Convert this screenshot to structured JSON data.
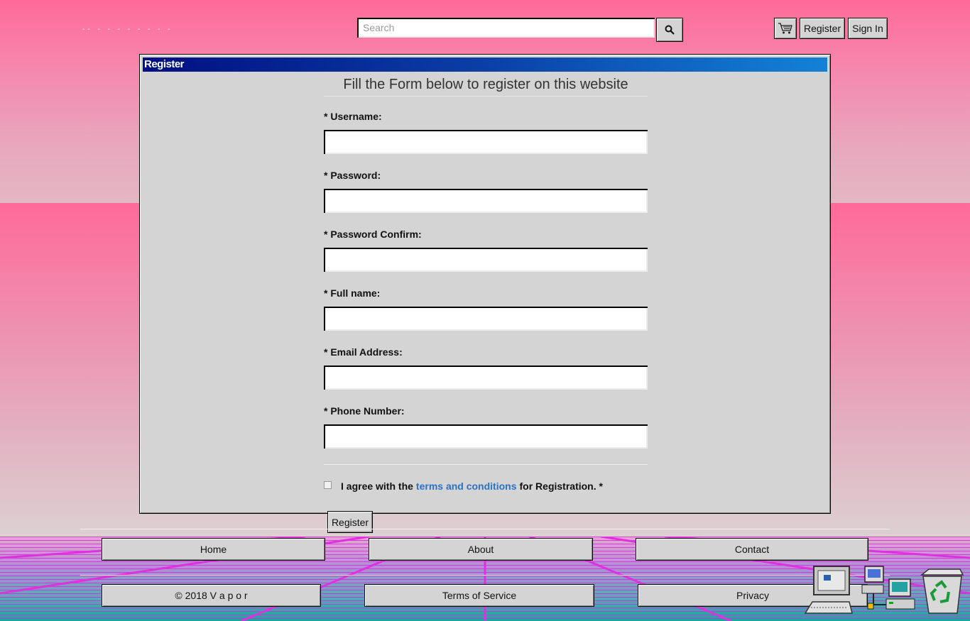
{
  "header": {
    "logo_text": "-- - - - - - - - -",
    "search": {
      "placeholder": "Search",
      "value": ""
    },
    "buttons": {
      "cart_icon": "cart-icon",
      "register": "Register",
      "sign_in": "Sign In"
    }
  },
  "window": {
    "title": "Register",
    "form_title": "Fill the Form below to register on this website",
    "fields": [
      {
        "label": "* Username:",
        "value": ""
      },
      {
        "label": "* Password:",
        "value": ""
      },
      {
        "label": "* Password Confirm:",
        "value": ""
      },
      {
        "label": "* Full name:",
        "value": ""
      },
      {
        "label": "* Email Address:",
        "value": ""
      },
      {
        "label": "* Phone Number:",
        "value": ""
      }
    ],
    "agree": {
      "prefix": "I agree with the",
      "link": "terms and conditions",
      "suffix": "for Registration. *",
      "checked": false
    },
    "submit": "Register"
  },
  "footer": {
    "row1": [
      "Home",
      "About",
      "Contact"
    ],
    "row2": [
      "© 2018 V a p o r",
      "Terms of Service",
      "Privacy"
    ]
  },
  "desktop_icons": [
    "my-computer-icon",
    "network-icon",
    "recycle-bin-icon"
  ],
  "colors": {
    "accent_link": "#2a72c4",
    "titlebar_start": "#000f82",
    "titlebar_end": "#1382d6",
    "window_bg": "#d4d4d4"
  }
}
